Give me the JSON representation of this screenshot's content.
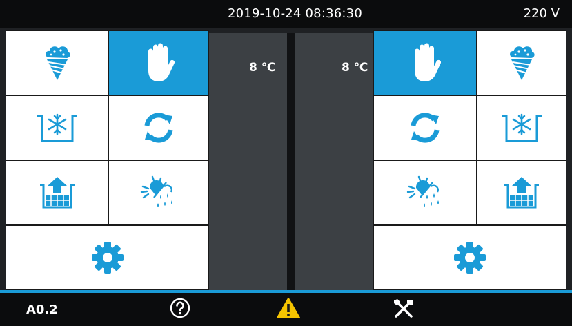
{
  "header": {
    "datetime": "2019-10-24  08:36:30",
    "voltage": "220 V"
  },
  "left": {
    "temperature": "8 ℃"
  },
  "right": {
    "temperature": "8 ℃"
  },
  "footer": {
    "code": "A0.2"
  },
  "colors": {
    "accent": "#1a9bd7",
    "panel": "#3c4044",
    "warning": "#f5c400"
  }
}
